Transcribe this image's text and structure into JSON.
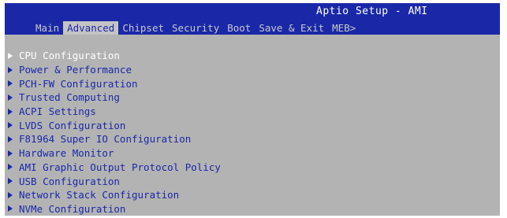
{
  "header": {
    "title": "Aptio Setup - AMI",
    "tabs": [
      {
        "label": "Main"
      },
      {
        "label": "Advanced"
      },
      {
        "label": "Chipset"
      },
      {
        "label": "Security"
      },
      {
        "label": "Boot"
      },
      {
        "label": "Save & Exit"
      },
      {
        "label": "MEB>"
      }
    ],
    "active_tab": "Advanced"
  },
  "menu": {
    "selected_item": "CPU Configuration",
    "items": [
      {
        "label": "CPU Configuration",
        "icon": "submenu-arrow-icon"
      },
      {
        "label": "Power & Performance",
        "icon": "submenu-arrow-icon"
      },
      {
        "label": "PCH-FW Configuration",
        "icon": "submenu-arrow-icon"
      },
      {
        "label": "Trusted Computing",
        "icon": "submenu-arrow-icon"
      },
      {
        "label": "ACPI Settings",
        "icon": "submenu-arrow-icon"
      },
      {
        "label": "LVDS Configuration",
        "icon": "submenu-arrow-icon"
      },
      {
        "label": "F81964 Super IO Configuration",
        "icon": "submenu-arrow-icon"
      },
      {
        "label": "Hardware Monitor",
        "icon": "submenu-arrow-icon"
      },
      {
        "label": "AMI Graphic Output Protocol Policy",
        "icon": "submenu-arrow-icon"
      },
      {
        "label": "USB Configuration",
        "icon": "submenu-arrow-icon"
      },
      {
        "label": "Network Stack Configuration",
        "icon": "submenu-arrow-icon"
      },
      {
        "label": "NVMe Configuration",
        "icon": "submenu-arrow-icon"
      }
    ]
  },
  "colors": {
    "header_bg": "#1a28a8",
    "body_bg": "#b3b3b3",
    "item_text": "#1a28a8",
    "selected_text": "#ffffff",
    "inactive_tab_text": "#c8c8c8",
    "active_tab_bg": "#c4c4c4"
  }
}
